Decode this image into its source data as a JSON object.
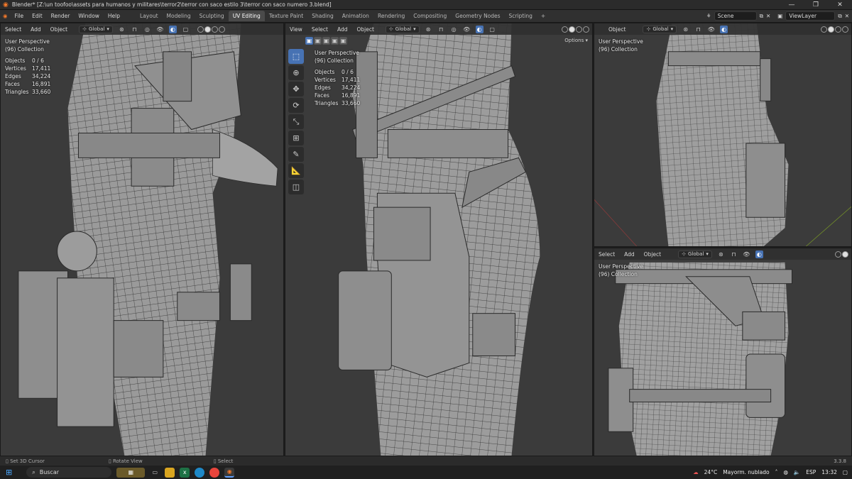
{
  "window": {
    "title": "Blender* [Z:\\un toofoo\\assets para humanos y militares\\terror2\\terror con saco estilo 3\\terror con saco numero 3.blend]",
    "minimize": "—",
    "maximize": "❐",
    "close": "✕"
  },
  "menu": {
    "items": [
      "File",
      "Edit",
      "Render",
      "Window",
      "Help"
    ],
    "workspaces": [
      "Layout",
      "Modeling",
      "Sculpting",
      "UV Editing",
      "Texture Paint",
      "Shading",
      "Animation",
      "Rendering",
      "Compositing",
      "Geometry Nodes",
      "Scripting"
    ],
    "active_workspace": "UV Editing",
    "add_tab": "+",
    "scene": "Scene",
    "view_layer": "ViewLayer"
  },
  "viewport": {
    "select": "Select",
    "add": "Add",
    "object": "Object",
    "view": "View",
    "transform": "Global",
    "options": "Options",
    "perspective": "User Perspective",
    "collection": "(96) Collection",
    "stats": [
      {
        "label": "Objects",
        "value": "0 / 6"
      },
      {
        "label": "Vertices",
        "value": "17,411"
      },
      {
        "label": "Edges",
        "value": "34,224"
      },
      {
        "label": "Faces",
        "value": "16,891"
      },
      {
        "label": "Triangles",
        "value": "33,660"
      }
    ]
  },
  "status": {
    "left": "Set 3D Cursor",
    "middle": "Rotate View",
    "right": "Select",
    "version": "3.3.8"
  },
  "taskbar": {
    "search": "Buscar",
    "weather_temp": "24°C",
    "weather_text": "Mayorm. nublado",
    "language": "ESP",
    "time": "13:32"
  },
  "colors": {
    "accent": "#4772b3",
    "viewport_bg": "#3b3b3b",
    "mesh_fill": "#9a9a9a",
    "wire": "#2a2a2a"
  }
}
